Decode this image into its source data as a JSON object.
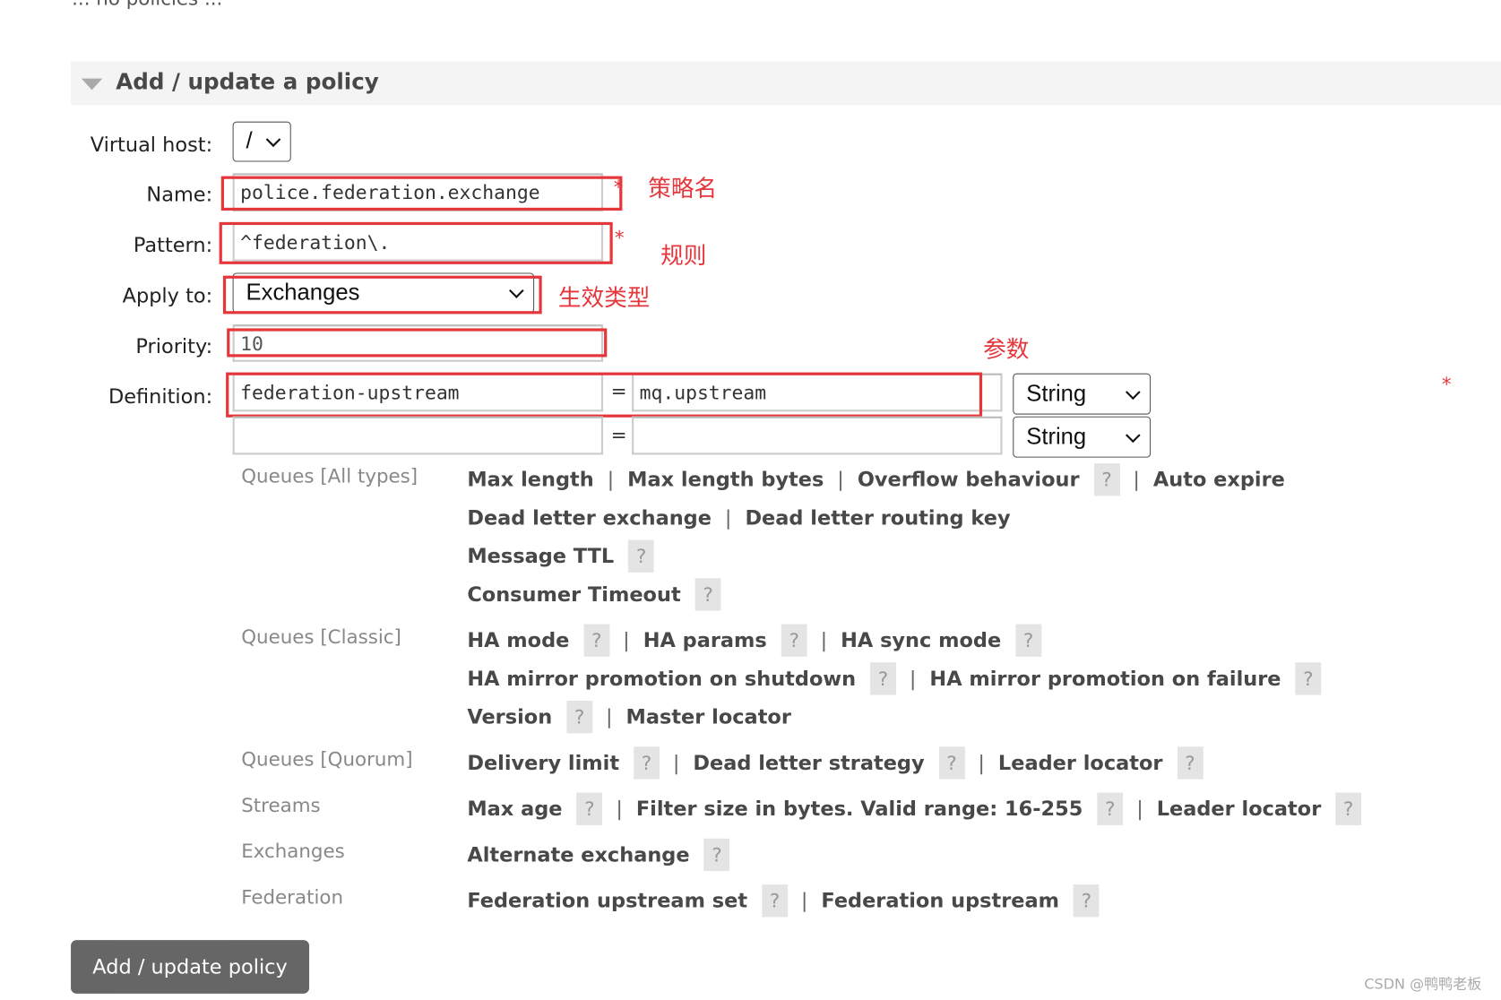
{
  "no_policies_text": "... no policies ...",
  "section": {
    "title": "Add / update a policy"
  },
  "form": {
    "labels": {
      "vhost": "Virtual host:",
      "name": "Name:",
      "pattern": "Pattern:",
      "apply_to": "Apply to:",
      "priority": "Priority:",
      "definition": "Definition:"
    },
    "vhost_value": "/",
    "name_value": "police.federation.exchange",
    "pattern_value": "^federation\\.",
    "apply_to_value": "Exchanges",
    "priority_value": "10",
    "required_mark": "*",
    "definition_rows": [
      {
        "key": "federation-upstream",
        "eq": "=",
        "value": "mq.upstream",
        "type": "String"
      },
      {
        "key": "",
        "eq": "=",
        "value": "",
        "type": "String"
      }
    ]
  },
  "annotations": {
    "name": "策略名",
    "pattern": "规则",
    "apply_to": "生效类型",
    "definition": "参数",
    "color": "#e5363b"
  },
  "categories": [
    {
      "label": "Queues [All types]",
      "rows": [
        [
          {
            "t": "Max length"
          },
          {
            "t": "Max length bytes"
          },
          {
            "t": "Overflow behaviour",
            "h": true
          },
          {
            "t": "Auto expire"
          }
        ],
        [
          {
            "t": "Dead letter exchange"
          },
          {
            "t": "Dead letter routing key"
          }
        ],
        [
          {
            "t": "Message TTL",
            "h": true
          }
        ],
        [
          {
            "t": "Consumer Timeout",
            "h": true
          }
        ]
      ]
    },
    {
      "label": "Queues [Classic]",
      "rows": [
        [
          {
            "t": "HA mode",
            "h": true
          },
          {
            "t": "HA params",
            "h": true
          },
          {
            "t": "HA sync mode",
            "h": true
          }
        ],
        [
          {
            "t": "HA mirror promotion on shutdown",
            "h": true
          },
          {
            "t": "HA mirror promotion on failure",
            "h": true
          }
        ],
        [
          {
            "t": "Version",
            "h": true
          },
          {
            "t": "Master locator"
          }
        ]
      ]
    },
    {
      "label": "Queues [Quorum]",
      "rows": [
        [
          {
            "t": "Delivery limit",
            "h": true
          },
          {
            "t": "Dead letter strategy",
            "h": true
          },
          {
            "t": "Leader locator",
            "h": true
          }
        ]
      ]
    },
    {
      "label": "Streams",
      "rows": [
        [
          {
            "t": "Max age",
            "h": true
          },
          {
            "t": "Filter size in bytes. Valid range: 16-255",
            "h": true
          },
          {
            "t": "Leader locator",
            "h": true
          }
        ]
      ]
    },
    {
      "label": "Exchanges",
      "rows": [
        [
          {
            "t": "Alternate exchange",
            "h": true
          }
        ]
      ]
    },
    {
      "label": "Federation",
      "rows": [
        [
          {
            "t": "Federation upstream set",
            "h": true
          },
          {
            "t": "Federation upstream",
            "h": true
          }
        ]
      ]
    }
  ],
  "help_label": "?",
  "separator": "|",
  "submit_label": "Add / update policy",
  "watermark": "CSDN @鸭鸭老板"
}
